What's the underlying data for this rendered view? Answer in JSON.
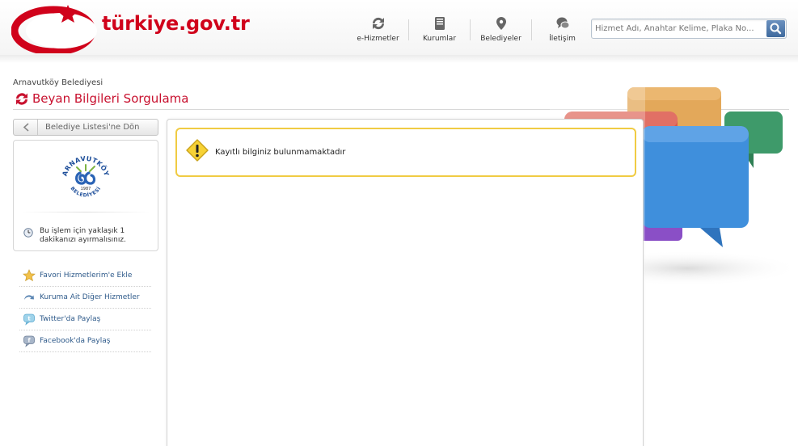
{
  "brand": {
    "logo_text": "türkiye.gov.tr"
  },
  "nav": {
    "items": [
      {
        "label": "e-Hizmetler",
        "icon": "refresh-icon"
      },
      {
        "label": "Kurumlar",
        "icon": "book-icon"
      },
      {
        "label": "Belediyeler",
        "icon": "map-pin-icon"
      },
      {
        "label": "İletişim",
        "icon": "chat-bubbles-icon"
      }
    ]
  },
  "search": {
    "placeholder": "Hizmet Adı, Anahtar Kelime, Plaka No...",
    "value": ""
  },
  "page": {
    "municipality": "Arnavutköy Belediyesi",
    "title": "Beyan Bilgileri Sorgulama"
  },
  "sidebar": {
    "back_label": "Belediye Listesi'ne Dön",
    "logo": {
      "top_text": "ARNAVUTKÖY",
      "bottom_text": "BELEDİYESİ",
      "year": "1987"
    },
    "duration_text": "Bu işlem için yaklaşık 1 dakikanızı ayırmalısınız.",
    "links": [
      {
        "label": "Favori Hizmetlerim'e Ekle",
        "icon": "star-icon"
      },
      {
        "label": "Kuruma Ait Diğer Hizmetler",
        "icon": "curved-arrow-icon"
      },
      {
        "label": "Twitter'da Paylaş",
        "icon": "twitter-bubble-icon"
      },
      {
        "label": "Facebook'da Paylaş",
        "icon": "facebook-bubble-icon"
      }
    ]
  },
  "alert": {
    "message": "Kayıtlı bilginiz bulunmamaktadır",
    "icon": "warning-icon"
  },
  "colors": {
    "brand_red": "#d0021b",
    "title_red": "#c8102e",
    "alert_border": "#f0cb43",
    "link_blue": "#2e5a8a"
  }
}
